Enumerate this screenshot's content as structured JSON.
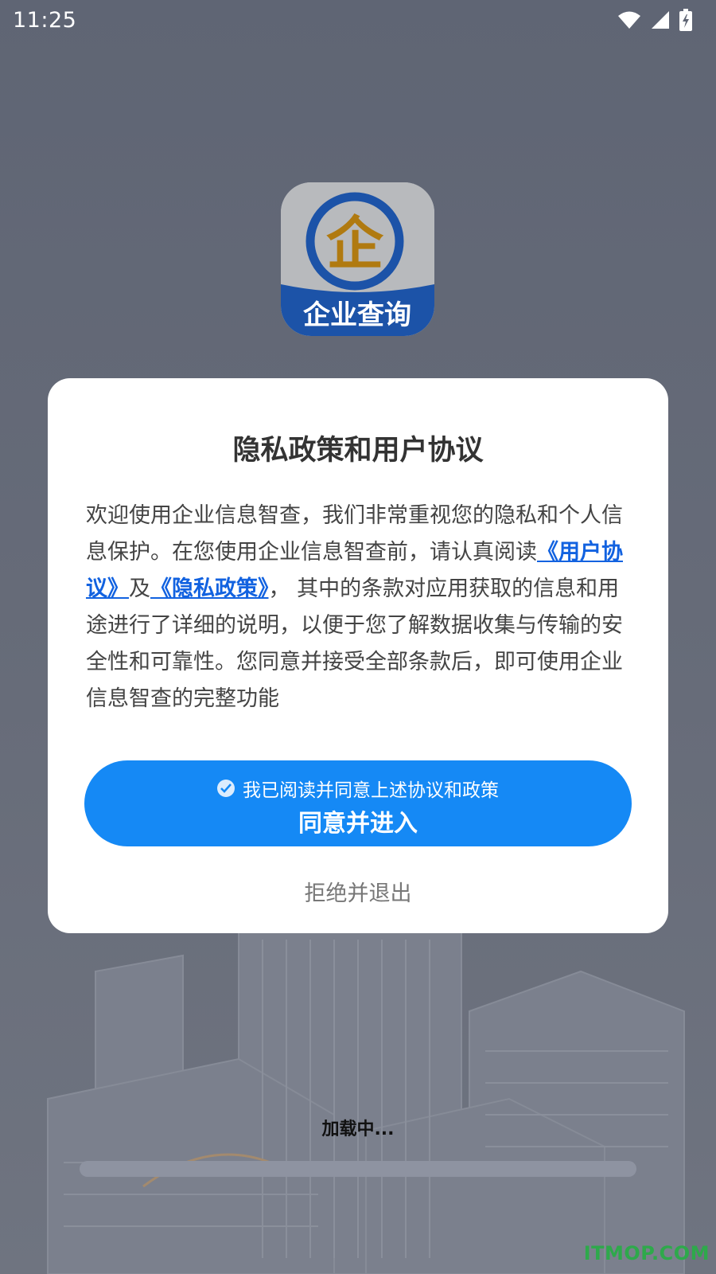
{
  "status_bar": {
    "time": "11:25"
  },
  "app_logo": {
    "glyph": "企",
    "label": "企业查询"
  },
  "dialog": {
    "title": "隐私政策和用户协议",
    "body": {
      "part1": "欢迎使用企业信息智查，我们非常重视您的隐私和个人信息保护。在您使用企业信息智查前，请认真阅读",
      "user_agreement_link": "《用户协议》",
      "connector": "及",
      "privacy_policy_link": "《隐私政策》",
      "part2": "， 其中的条款对应用获取的信息和用途进行了详细的说明，以便于您了解数据收集与传输的安全性和可靠性。您同意并接受全部条款后，即可使用企业信息智查的完整功能"
    },
    "agree_button": {
      "check_text": "我已阅读并同意上述协议和政策",
      "label": "同意并进入",
      "checked": true
    },
    "reject_label": "拒绝并退出"
  },
  "loading": {
    "text": "加载中...",
    "progress": 0
  },
  "watermark": "ITMOP.COM",
  "colors": {
    "accent": "#1589f5",
    "link": "#1262e0",
    "logo_blue": "#1c53a8",
    "logo_gold": "#b07a10"
  }
}
